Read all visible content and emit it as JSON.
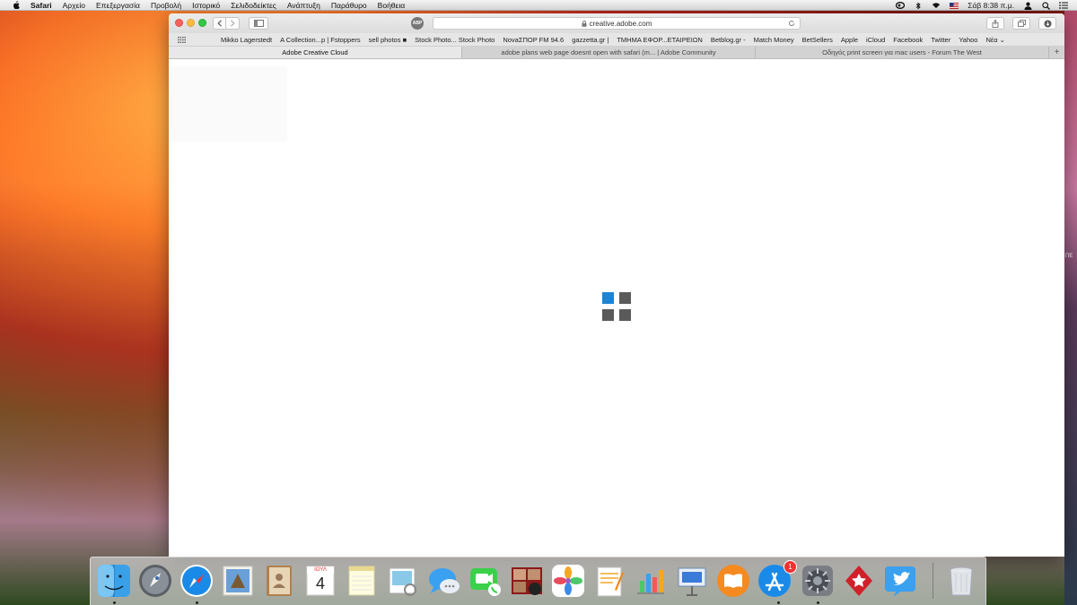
{
  "menubar": {
    "items": [
      "Safari",
      "Αρχείο",
      "Επεξεργασία",
      "Προβολή",
      "Ιστορικό",
      "Σελιδοδείκτες",
      "Ανάπτυξη",
      "Παράθυρο",
      "Βοήθεια"
    ],
    "clock": "Σάβ 8:38 π.μ."
  },
  "browser": {
    "url": "creative.adobe.com",
    "extension_label": "ABP",
    "bookmarks": [
      "Mikko Lagerstedt",
      "A Collection...p | Fstoppers",
      "sell photos ■",
      "Stock Photo... Stock Photo",
      "NovaΣΠΟΡ FM 94.6",
      "gazzetta.gr |",
      "ΤΜΗΜΑ ΕΦΟΡ...ΕΤΑΙΡΕΙΩΝ",
      "Betblog.gr -",
      "Match Money",
      "BetSellers",
      "Apple",
      "iCloud",
      "Facebook",
      "Twitter",
      "Yahoo",
      "Νέα ⌄"
    ],
    "tabs": [
      "Adobe Creative Cloud",
      "adobe plans web page doesnt open with safari (m... | Adobe Community",
      "Οδηγός print screen για mac users - Forum The West"
    ],
    "new_tab_label": "+"
  },
  "loader": {
    "colors": [
      "#1c84d4",
      "#5a5a5a",
      "#5a5a5a",
      "#5a5a5a"
    ]
  },
  "calendar": {
    "month": "ΙΟΥΛ",
    "day": "4"
  },
  "dock": {
    "appstore_badge": "1",
    "icons": [
      "finder-icon",
      "launchpad-icon",
      "safari-icon",
      "mail-icon",
      "contacts-icon",
      "calendar-icon",
      "notes-icon",
      "preview-icon",
      "messages-icon",
      "facetime-icon",
      "photo-booth-icon",
      "photos-icon",
      "pages-icon",
      "numbers-icon",
      "keynote-icon",
      "ibooks-icon",
      "app-store-icon",
      "system-preferences-icon",
      "pokerstars-icon",
      "twitter-icon",
      "trash-icon"
    ]
  },
  "desktop": {
    "edge_label": "ΠΕ"
  }
}
